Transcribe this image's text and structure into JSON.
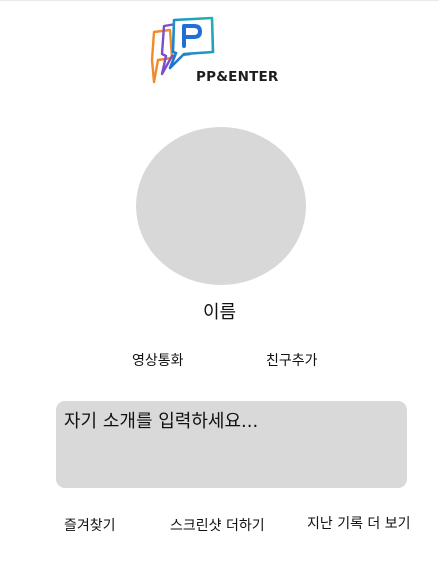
{
  "brand": {
    "name": "PP&ENTER",
    "logo_icon": "speech-bubble-p-logo"
  },
  "profile": {
    "name_label": "이름"
  },
  "actions": {
    "video_call": "영상통화",
    "add_friend": "친구추가"
  },
  "bio": {
    "placeholder": "자기 소개를 입력하세요..."
  },
  "bottom_nav": {
    "favorites": "즐겨찾기",
    "more_screenshots": "스크린샷 더하기",
    "more_history": "지난 기록 더 보기"
  },
  "colors": {
    "avatar": "#d8d8d8",
    "bio_background": "#d9d9d9",
    "logo_orange": "#f28a2a",
    "logo_purple": "#7b4fc9",
    "logo_blue": "#1f6fd6",
    "logo_teal": "#1fb5b0"
  }
}
